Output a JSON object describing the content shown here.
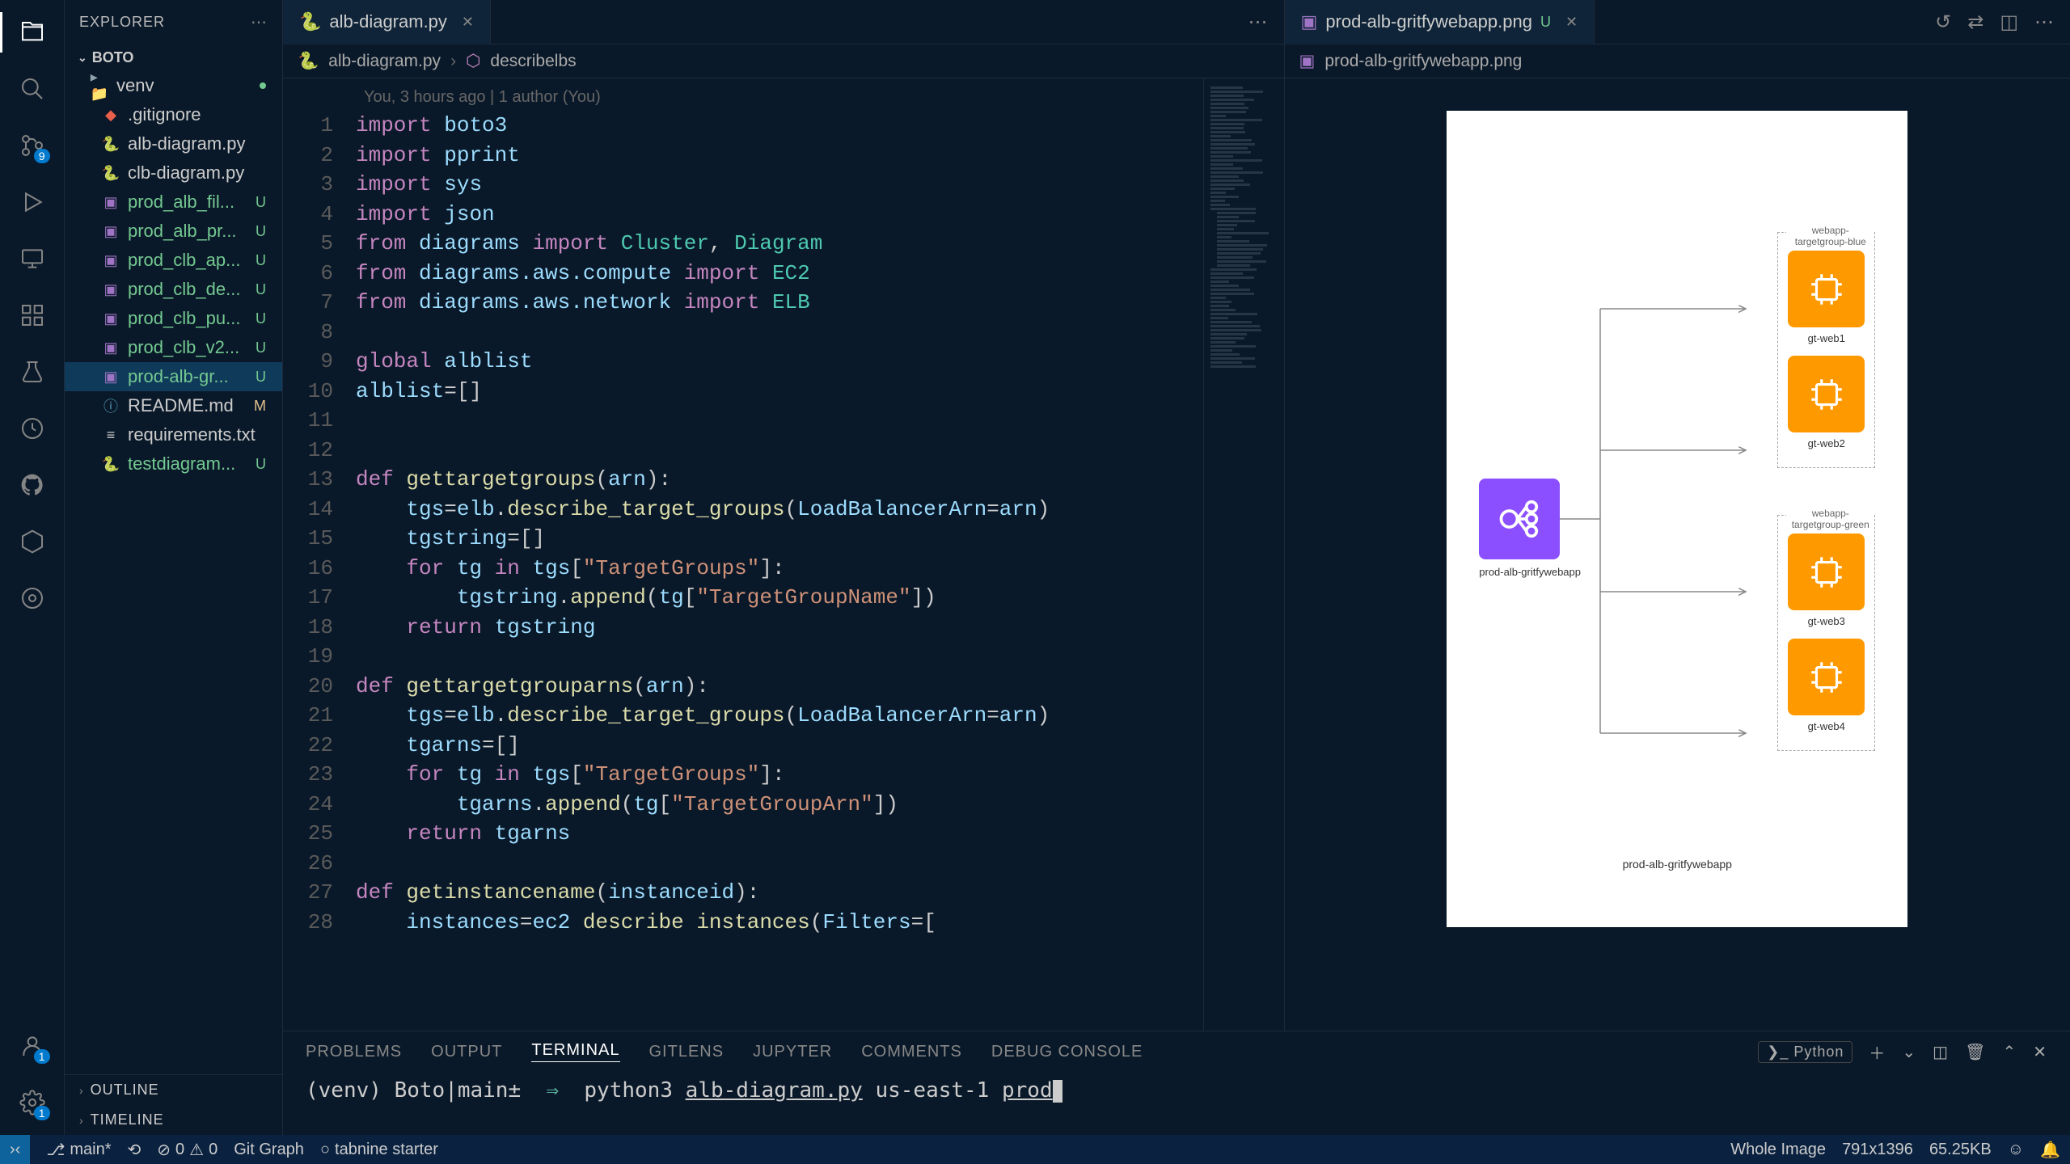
{
  "sidebar": {
    "title": "EXPLORER",
    "root": "BOTO",
    "items": [
      {
        "name": "venv",
        "type": "folder",
        "marker": "dot"
      },
      {
        "name": ".gitignore",
        "type": "git"
      },
      {
        "name": "alb-diagram.py",
        "type": "py"
      },
      {
        "name": "clb-diagram.py",
        "type": "py"
      },
      {
        "name": "prod_alb_fil...",
        "type": "img",
        "marker": "U",
        "untracked": true
      },
      {
        "name": "prod_alb_pr...",
        "type": "img",
        "marker": "U",
        "untracked": true
      },
      {
        "name": "prod_clb_ap...",
        "type": "img",
        "marker": "U",
        "untracked": true
      },
      {
        "name": "prod_clb_de...",
        "type": "img",
        "marker": "U",
        "untracked": true
      },
      {
        "name": "prod_clb_pu...",
        "type": "img",
        "marker": "U",
        "untracked": true
      },
      {
        "name": "prod_clb_v2...",
        "type": "img",
        "marker": "U",
        "untracked": true
      },
      {
        "name": "prod-alb-gr...",
        "type": "img",
        "marker": "U",
        "untracked": true,
        "selected": true
      },
      {
        "name": "README.md",
        "type": "md",
        "marker": "M",
        "modified": true
      },
      {
        "name": "requirements.txt",
        "type": "txt"
      },
      {
        "name": "testdiagram...",
        "type": "py",
        "marker": "U",
        "untracked": true
      }
    ],
    "outline": "OUTLINE",
    "timeline": "TIMELINE"
  },
  "activity": {
    "scm_badge": "9",
    "account_badge": "1",
    "settings_badge": "1"
  },
  "editor": {
    "tab1": {
      "name": "alb-diagram.py"
    },
    "tab2": {
      "name": "prod-alb-gritfywebapp.png",
      "marker": "U"
    },
    "breadcrumb1": "alb-diagram.py",
    "breadcrumb2": "describelbs",
    "breadcrumb_img": "prod-alb-gritfywebapp.png",
    "blame": "You, 3 hours ago | 1 author (You)",
    "code": [
      {
        "n": 1,
        "html": "<span class='kw'>import</span> <span class='var'>boto3</span>"
      },
      {
        "n": 2,
        "html": "<span class='kw'>import</span> <span class='var'>pprint</span>"
      },
      {
        "n": 3,
        "html": "<span class='kw'>import</span> <span class='var'>sys</span>"
      },
      {
        "n": 4,
        "html": "<span class='kw'>import</span> <span class='var'>json</span>"
      },
      {
        "n": 5,
        "html": "<span class='kw'>from</span> <span class='var'>diagrams</span> <span class='kw'>import</span> <span class='cls'>Cluster</span>, <span class='cls'>Diagram</span>"
      },
      {
        "n": 6,
        "html": "<span class='kw'>from</span> <span class='var'>diagrams.aws.compute</span> <span class='kw'>import</span> <span class='cls'>EC2</span>"
      },
      {
        "n": 7,
        "html": "<span class='kw'>from</span> <span class='var'>diagrams.aws.network</span> <span class='kw'>import</span> <span class='cls'>ELB</span>"
      },
      {
        "n": 8,
        "html": ""
      },
      {
        "n": 9,
        "html": "<span class='kw'>global</span> <span class='var'>alblist</span>"
      },
      {
        "n": 10,
        "html": "<span class='var'>alblist</span>=[]"
      },
      {
        "n": 11,
        "html": ""
      },
      {
        "n": 12,
        "html": ""
      },
      {
        "n": 13,
        "html": "<span class='kw'>def</span> <span class='fn'>gettargetgroups</span>(<span class='var'>arn</span>):"
      },
      {
        "n": 14,
        "html": "    <span class='var'>tgs</span>=<span class='var'>elb</span>.<span class='fn'>describe_target_groups</span>(<span class='var'>LoadBalancerArn</span>=<span class='var'>arn</span>)"
      },
      {
        "n": 15,
        "html": "    <span class='var'>tgstring</span>=[]"
      },
      {
        "n": 16,
        "html": "    <span class='kw'>for</span> <span class='var'>tg</span> <span class='kw'>in</span> <span class='var'>tgs</span>[<span class='str'>\"TargetGroups\"</span>]:"
      },
      {
        "n": 17,
        "html": "        <span class='var'>tgstring</span>.<span class='fn'>append</span>(<span class='var'>tg</span>[<span class='str'>\"TargetGroupName\"</span>])"
      },
      {
        "n": 18,
        "html": "    <span class='kw'>return</span> <span class='var'>tgstring</span>"
      },
      {
        "n": 19,
        "html": ""
      },
      {
        "n": 20,
        "html": "<span class='kw'>def</span> <span class='fn'>gettargetgrouparns</span>(<span class='var'>arn</span>):"
      },
      {
        "n": 21,
        "html": "    <span class='var'>tgs</span>=<span class='var'>elb</span>.<span class='fn'>describe_target_groups</span>(<span class='var'>LoadBalancerArn</span>=<span class='var'>arn</span>)"
      },
      {
        "n": 22,
        "html": "    <span class='var'>tgarns</span>=[]"
      },
      {
        "n": 23,
        "html": "    <span class='kw'>for</span> <span class='var'>tg</span> <span class='kw'>in</span> <span class='var'>tgs</span>[<span class='str'>\"TargetGroups\"</span>]:"
      },
      {
        "n": 24,
        "html": "        <span class='var'>tgarns</span>.<span class='fn'>append</span>(<span class='var'>tg</span>[<span class='str'>\"TargetGroupArn\"</span>])"
      },
      {
        "n": 25,
        "html": "    <span class='kw'>return</span> <span class='var'>tgarns</span>"
      },
      {
        "n": 26,
        "html": ""
      },
      {
        "n": 27,
        "html": "<span class='kw'>def</span> <span class='fn'>getinstancename</span>(<span class='var'>instanceid</span>):"
      },
      {
        "n": 28,
        "html": "    <span class='var'>instances</span>=<span class='var'>ec2</span> <span class='fn'>describe instances</span>(<span class='var'>Filters</span>=["
      }
    ]
  },
  "diagram": {
    "title": "prod-alb-gritfywebapp",
    "elb_label": "prod-alb-gritfywebapp",
    "cluster1": "webapp-targetgroup-blue",
    "cluster2": "webapp-targetgroup-green",
    "web1": "gt-web1",
    "web2": "gt-web2",
    "web3": "gt-web3",
    "web4": "gt-web4"
  },
  "panel": {
    "tabs": [
      "PROBLEMS",
      "OUTPUT",
      "TERMINAL",
      "GITLENS",
      "JUPYTER",
      "COMMENTS",
      "DEBUG CONSOLE"
    ],
    "pylabel": "Python",
    "prompt_venv": "(venv)",
    "prompt_path": "Boto|main±",
    "prompt_arrow": "⇒",
    "cmd_py": "python3",
    "cmd_file": "alb-diagram.py",
    "cmd_arg1": "us-east-1",
    "cmd_arg2": "prod"
  },
  "status": {
    "branch": "main*",
    "sync": "⟲",
    "errors": "0",
    "warnings": "0",
    "gitgraph": "Git Graph",
    "tabnine": "tabnine starter",
    "whole_image": "Whole Image",
    "dimensions": "791x1396",
    "filesize": "65.25KB"
  }
}
